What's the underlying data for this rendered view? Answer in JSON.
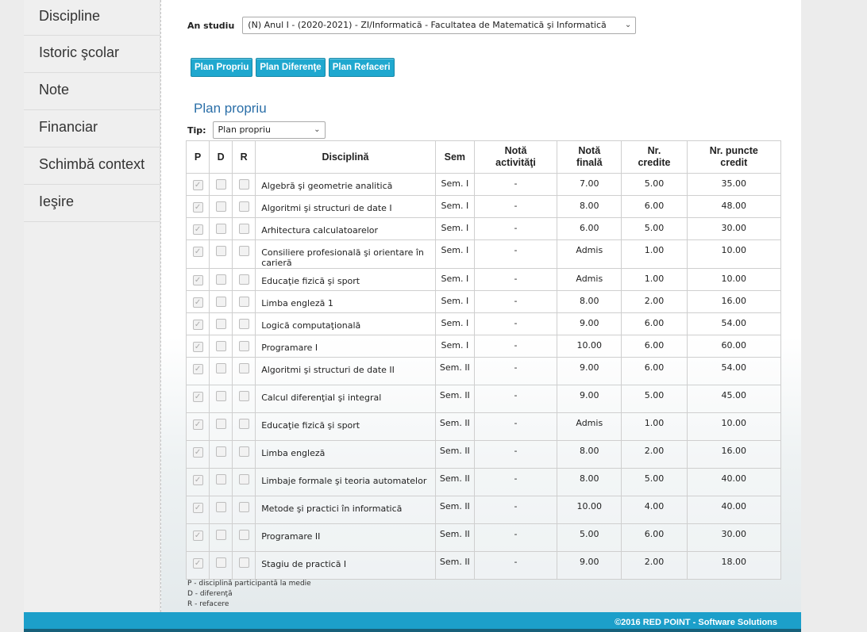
{
  "sidebar": {
    "items": [
      {
        "label": "Discipline"
      },
      {
        "label": "Istoric şcolar"
      },
      {
        "label": "Note"
      },
      {
        "label": "Financiar"
      },
      {
        "label": "Schimbă context"
      },
      {
        "label": "Ieşire"
      }
    ]
  },
  "an_studiu": {
    "label": "An studiu",
    "value": "(N) Anul I - (2020-2021) - ZI/Informatică - Facultatea de Matematică şi Informatică"
  },
  "buttons": {
    "plan_propriu": "Plan Propriu",
    "plan_diferente": "Plan Diferenţe",
    "plan_refaceri": "Plan Refaceri"
  },
  "section_title": "Plan propriu",
  "tip": {
    "label": "Tip:",
    "value": "Plan propriu"
  },
  "table": {
    "headers": {
      "p": "P",
      "d": "D",
      "r": "R",
      "disciplina": "Disciplină",
      "sem": "Sem",
      "nota_act_1": "Notă",
      "nota_act_2": "activităţi",
      "nota_fin_1": "Notă",
      "nota_fin_2": "finală",
      "credite_1": "Nr.",
      "credite_2": "credite",
      "puncte_1": "Nr. puncte",
      "puncte_2": "credit"
    },
    "rows": [
      {
        "name": "Algebră şi geometrie analitică",
        "sem": "Sem. I",
        "act": "-",
        "final": "7.00",
        "credite": "5.00",
        "puncte": "35.00"
      },
      {
        "name": "Algoritmi şi structuri de date I",
        "sem": "Sem. I",
        "act": "-",
        "final": "8.00",
        "credite": "6.00",
        "puncte": "48.00"
      },
      {
        "name": "Arhitectura calculatoarelor",
        "sem": "Sem. I",
        "act": "-",
        "final": "6.00",
        "credite": "5.00",
        "puncte": "30.00"
      },
      {
        "name": "Consiliere profesională şi orientare în carieră",
        "sem": "Sem. I",
        "act": "-",
        "final": "Admis",
        "credite": "1.00",
        "puncte": "10.00"
      },
      {
        "name": "Educaţie fizică şi sport",
        "sem": "Sem. I",
        "act": "-",
        "final": "Admis",
        "credite": "1.00",
        "puncte": "10.00"
      },
      {
        "name": "Limba engleză 1",
        "sem": "Sem. I",
        "act": "-",
        "final": "8.00",
        "credite": "2.00",
        "puncte": "16.00"
      },
      {
        "name": "Logică computaţională",
        "sem": "Sem. I",
        "act": "-",
        "final": "9.00",
        "credite": "6.00",
        "puncte": "54.00"
      },
      {
        "name": "Programare I",
        "sem": "Sem. I",
        "act": "-",
        "final": "10.00",
        "credite": "6.00",
        "puncte": "60.00"
      },
      {
        "name": "Algoritmi şi structuri de date II",
        "sem": "Sem. II",
        "act": "-",
        "final": "9.00",
        "credite": "6.00",
        "puncte": "54.00"
      },
      {
        "name": "Calcul diferenţial şi integral",
        "sem": "Sem. II",
        "act": "-",
        "final": "9.00",
        "credite": "5.00",
        "puncte": "45.00"
      },
      {
        "name": "Educaţie fizică şi sport",
        "sem": "Sem. II",
        "act": "-",
        "final": "Admis",
        "credite": "1.00",
        "puncte": "10.00"
      },
      {
        "name": "Limba engleză",
        "sem": "Sem. II",
        "act": "-",
        "final": "8.00",
        "credite": "2.00",
        "puncte": "16.00"
      },
      {
        "name": "Limbaje formale şi teoria automatelor",
        "sem": "Sem. II",
        "act": "-",
        "final": "8.00",
        "credite": "5.00",
        "puncte": "40.00"
      },
      {
        "name": "Metode şi practici în informatică",
        "sem": "Sem. II",
        "act": "-",
        "final": "10.00",
        "credite": "4.00",
        "puncte": "40.00"
      },
      {
        "name": "Programare II",
        "sem": "Sem. II",
        "act": "-",
        "final": "5.00",
        "credite": "6.00",
        "puncte": "30.00"
      },
      {
        "name": "Stagiu de practică I",
        "sem": "Sem. II",
        "act": "-",
        "final": "9.00",
        "credite": "2.00",
        "puncte": "18.00"
      }
    ]
  },
  "legend": [
    "P - disciplină participantă la medie",
    "D - diferenţă",
    "R - refacere"
  ],
  "footer": "©2016 RED POINT - Software Solutions",
  "icons": {
    "chevron": "chevron-down-icon",
    "check": "checkmark-icon"
  }
}
